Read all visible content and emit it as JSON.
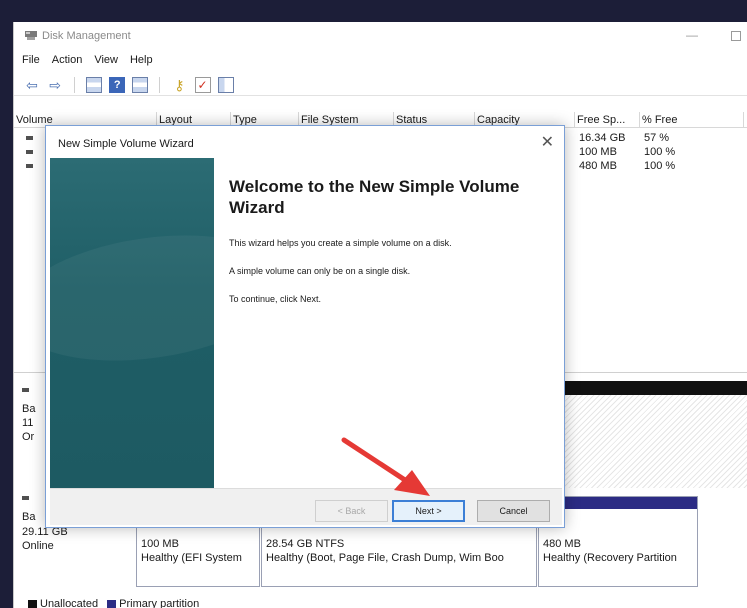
{
  "window": {
    "title": "Disk Management",
    "min_glyph": "—"
  },
  "menu": [
    "File",
    "Action",
    "View",
    "Help"
  ],
  "toolbar": {
    "help_glyph": "?",
    "check_glyph": "✓",
    "back_arrow": "⇦",
    "forward_arrow": "⇨",
    "key_glyph": "⚷"
  },
  "volume_table": {
    "columns": [
      "Volume",
      "Layout",
      "Type",
      "File System",
      "Status",
      "Capacity",
      "Free Sp...",
      "% Free"
    ],
    "rows": [
      {
        "free_space": "16.34 GB",
        "percent_free": "57 %"
      },
      {
        "free_space": "100 MB",
        "percent_free": "100 %"
      },
      {
        "free_space": "480 MB",
        "percent_free": "100 %"
      }
    ]
  },
  "disk0_stub": [
    "Ba",
    "11",
    "Or"
  ],
  "disk1": {
    "name": "Ba",
    "size": "29.11 GB",
    "status": "Online",
    "partitions": [
      {
        "size": "100 MB",
        "info": "Healthy (EFI System"
      },
      {
        "size": "28.54 GB NTFS",
        "info": "Healthy (Boot, Page File, Crash Dump, Wim Boo"
      },
      {
        "size": "480 MB",
        "info": "Healthy (Recovery Partition"
      }
    ]
  },
  "legend": [
    {
      "label": "Unallocated",
      "color": "#111111"
    },
    {
      "label": "Primary partition",
      "color": "#2c2c84"
    }
  ],
  "wizard": {
    "title": "New Simple Volume Wizard",
    "close_glyph": "✕",
    "heading": "Welcome to the New Simple Volume Wizard",
    "paragraphs": [
      "This wizard helps you create a simple volume on a disk.",
      "A simple volume can only be on a single disk.",
      "To continue, click Next."
    ],
    "buttons": {
      "back": "< Back",
      "next": "Next >",
      "cancel": "Cancel"
    }
  },
  "colors": {
    "annotation_arrow": "#e53935",
    "wizard_side_panel": "#1f5e66",
    "primary_partition": "#2c2c84"
  }
}
